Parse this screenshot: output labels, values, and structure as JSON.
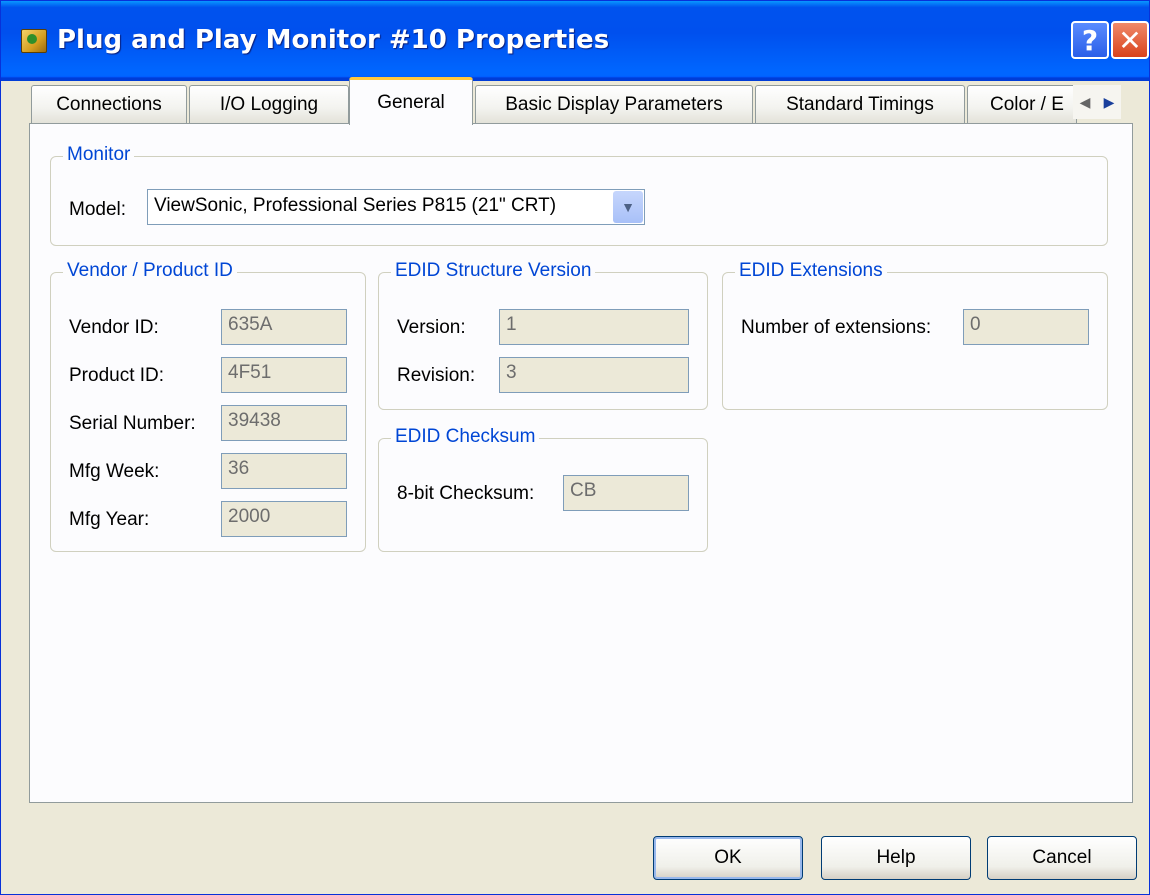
{
  "window": {
    "title": "Plug and Play Monitor #10 Properties"
  },
  "title_buttons": {
    "help": "?",
    "close": "✕"
  },
  "tabs": [
    {
      "label": "Connections"
    },
    {
      "label": "I/O Logging"
    },
    {
      "label": "General"
    },
    {
      "label": "Basic Display Parameters"
    },
    {
      "label": "Standard Timings"
    },
    {
      "label": "Color / E"
    }
  ],
  "active_tab": "General",
  "monitor": {
    "title": "Monitor",
    "model_label": "Model:",
    "model_value": "ViewSonic, Professional Series P815 (21\" CRT)"
  },
  "vendor": {
    "title": "Vendor / Product ID",
    "fields": [
      {
        "label": "Vendor ID:",
        "value": "635A"
      },
      {
        "label": "Product ID:",
        "value": "4F51"
      },
      {
        "label": "Serial Number:",
        "value": "39438"
      },
      {
        "label": "Mfg Week:",
        "value": "36"
      },
      {
        "label": "Mfg Year:",
        "value": "2000"
      }
    ]
  },
  "edid_version": {
    "title": "EDID Structure Version",
    "fields": [
      {
        "label": "Version:",
        "value": "1"
      },
      {
        "label": "Revision:",
        "value": "3"
      }
    ]
  },
  "edid_checksum": {
    "title": "EDID Checksum",
    "label": "8-bit Checksum:",
    "value": "CB"
  },
  "edid_extensions": {
    "title": "EDID Extensions",
    "label": "Number of extensions:",
    "value": "0"
  },
  "buttons": {
    "ok": "OK",
    "help": "Help",
    "cancel": "Cancel"
  },
  "icons": {
    "title_icon": "monitor-properties-icon",
    "dropdown": "chevron-down-icon",
    "scroll_left": "chevron-left-icon",
    "scroll_right": "chevron-right-icon"
  },
  "colors": {
    "titlebar": "#0054e3",
    "group_title": "#0046d5",
    "active_tab_accent": "#ffc83c"
  }
}
